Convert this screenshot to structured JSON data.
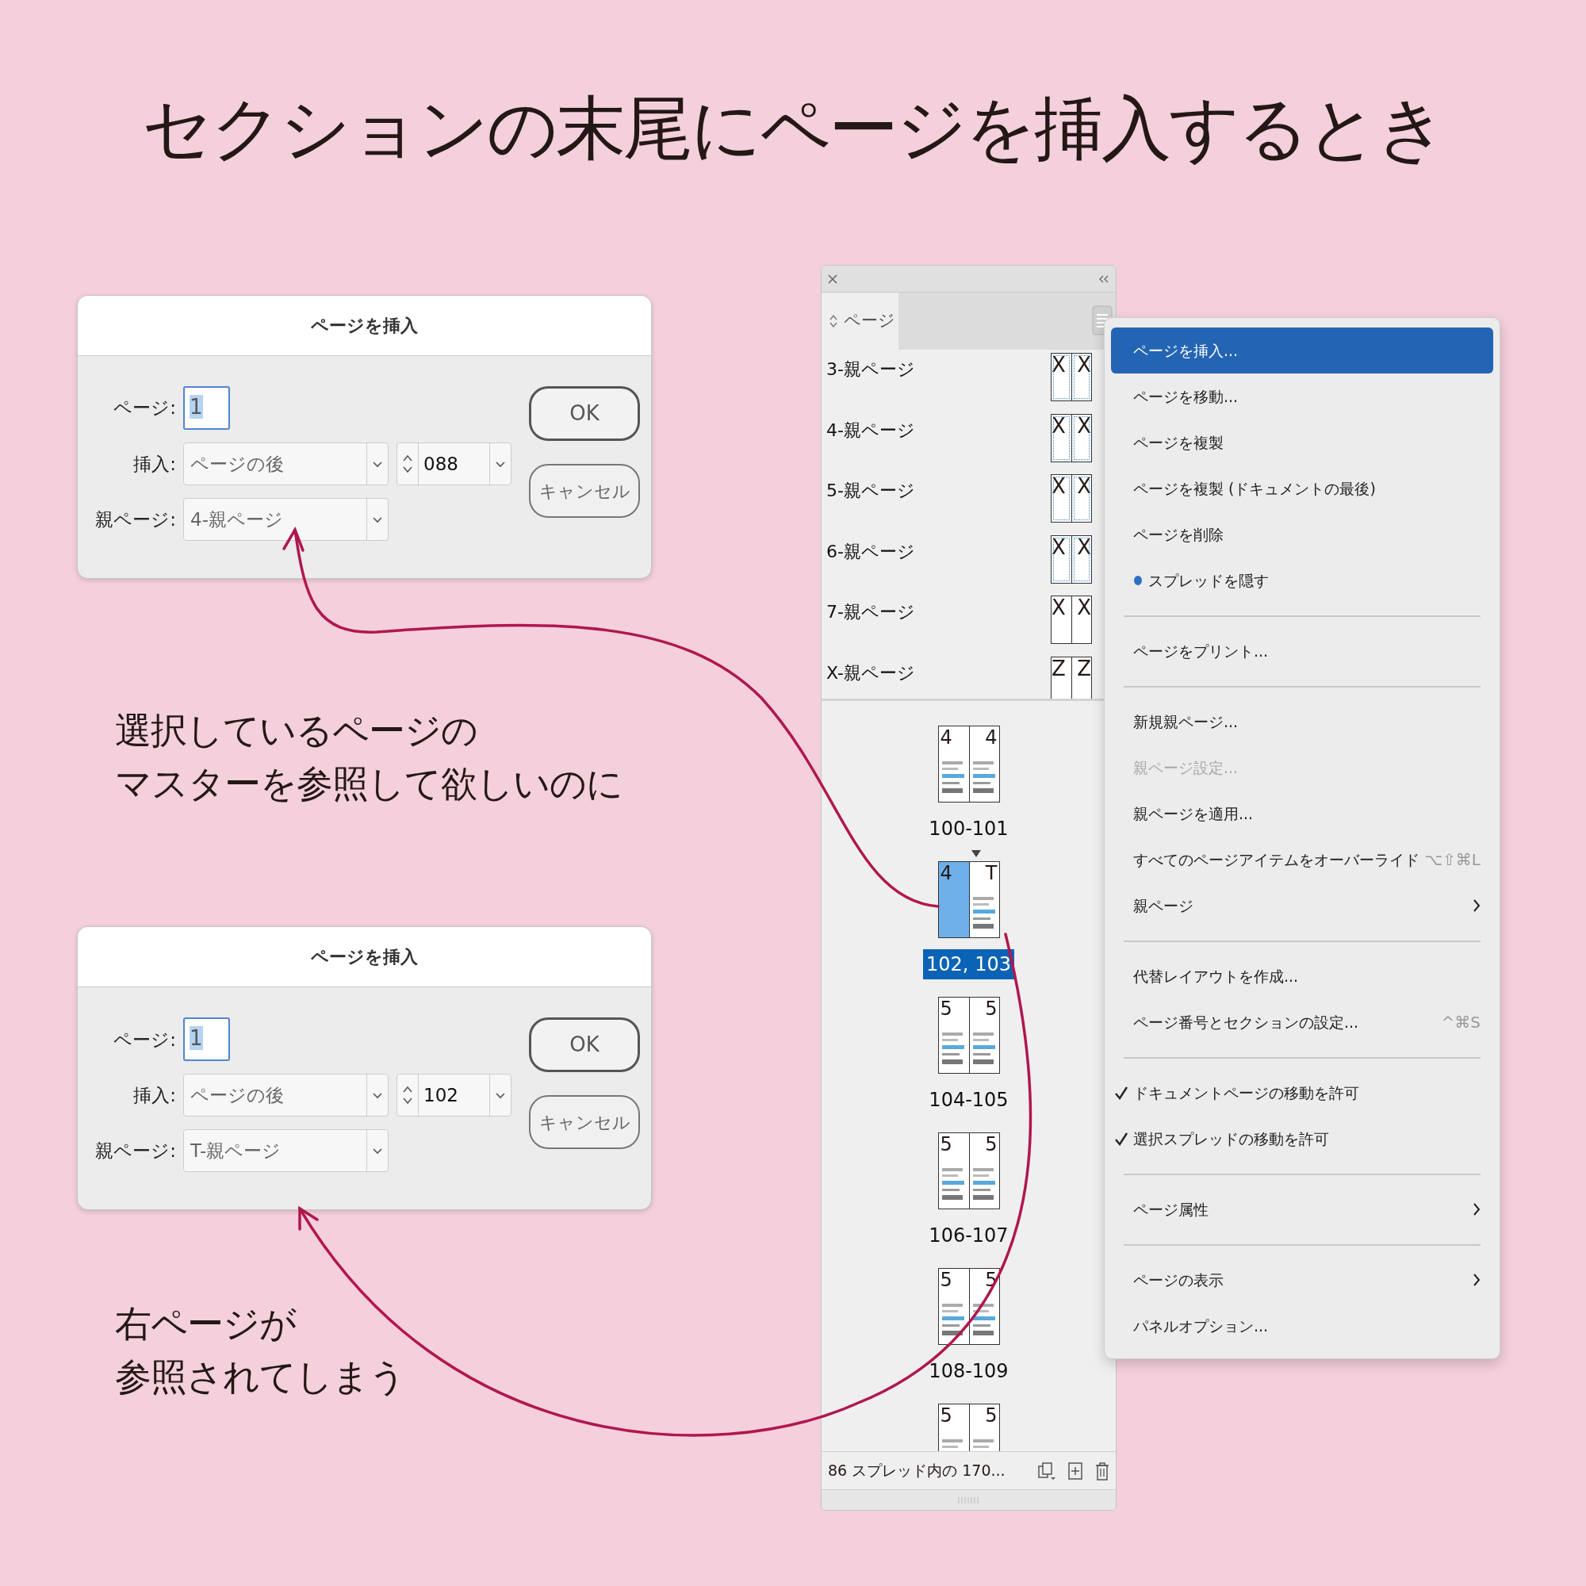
{
  "title": "セクションの末尾にページを挿入するとき",
  "sections": [
    {
      "dialog": {
        "title": "ページを挿入",
        "page_label": "ページ:",
        "page_value": "1",
        "insert_label": "挿入:",
        "insert_value": "ページの後",
        "insert_page": "088",
        "parent_label": "親ページ:",
        "parent_value": "4-親ページ",
        "ok": "OK",
        "cancel": "キャンセル"
      },
      "caption": [
        "選択しているページの",
        "マスターを参照して欲しいのに"
      ]
    },
    {
      "dialog": {
        "title": "ページを挿入",
        "page_label": "ページ:",
        "page_value": "1",
        "insert_label": "挿入:",
        "insert_value": "ページの後",
        "insert_page": "102",
        "parent_label": "親ページ:",
        "parent_value": "T-親ページ",
        "ok": "OK",
        "cancel": "キャンセル"
      },
      "caption": [
        "右ページが",
        "参照されてしまう"
      ]
    }
  ],
  "panel": {
    "tab": "ページ",
    "masters": [
      {
        "name": "3-親ページ",
        "left": "X",
        "right": "X",
        "guides": true
      },
      {
        "name": "4-親ページ",
        "left": "X",
        "right": "X",
        "guides": true
      },
      {
        "name": "5-親ページ",
        "left": "X",
        "right": "X",
        "guides": true
      },
      {
        "name": "6-親ページ",
        "left": "X",
        "right": "X",
        "guides": true
      },
      {
        "name": "7-親ページ",
        "left": "X",
        "right": "X",
        "guides": false
      },
      {
        "name": "X-親ページ",
        "left": "Z",
        "right": "Z",
        "guides": false
      }
    ],
    "spreads": [
      {
        "label": "100-101",
        "selected": false,
        "pages": [
          {
            "letter": "4",
            "selected": false
          },
          {
            "letter": "4",
            "selected": false
          }
        ]
      },
      {
        "label": "102, 103",
        "selected": true,
        "pages": [
          {
            "letter": "4",
            "selected": true
          },
          {
            "letter": "T",
            "selected": false,
            "current": true
          }
        ]
      },
      {
        "label": "104-105",
        "selected": false,
        "pages": [
          {
            "letter": "5",
            "selected": false
          },
          {
            "letter": "5",
            "selected": false
          }
        ]
      },
      {
        "label": "106-107",
        "selected": false,
        "pages": [
          {
            "letter": "5",
            "selected": false
          },
          {
            "letter": "5",
            "selected": false
          }
        ]
      },
      {
        "label": "108-109",
        "selected": false,
        "pages": [
          {
            "letter": "5",
            "selected": false
          },
          {
            "letter": "5",
            "selected": false
          }
        ]
      },
      {
        "pages": [
          {
            "letter": "5",
            "selected": false
          },
          {
            "letter": "5",
            "selected": false
          }
        ]
      }
    ],
    "footer": "86 スプレッド内の 170..."
  },
  "menu": {
    "items": [
      {
        "kind": "item",
        "label": "ページを挿入...",
        "selected": true,
        "disabled": false
      },
      {
        "kind": "item",
        "label": "ページを移動...",
        "selected": false,
        "disabled": false
      },
      {
        "kind": "item",
        "label": "ページを複製",
        "selected": false,
        "disabled": false
      },
      {
        "kind": "item",
        "label": "ページを複製 (ドキュメントの最後)",
        "selected": false,
        "disabled": false
      },
      {
        "kind": "item",
        "label": "ページを削除",
        "selected": false,
        "disabled": false
      },
      {
        "kind": "item",
        "label": "スプレッドを隠す",
        "selected": false,
        "disabled": false,
        "bullet": true
      },
      {
        "kind": "separator"
      },
      {
        "kind": "item",
        "label": "ページをプリント...",
        "selected": false,
        "disabled": false
      },
      {
        "kind": "separator"
      },
      {
        "kind": "item",
        "label": "新規親ページ...",
        "selected": false,
        "disabled": false
      },
      {
        "kind": "item",
        "label": "親ページ設定...",
        "selected": false,
        "disabled": true
      },
      {
        "kind": "item",
        "label": "親ページを適用...",
        "selected": false,
        "disabled": false
      },
      {
        "kind": "item",
        "label": "すべてのページアイテムをオーバーライド",
        "selected": false,
        "disabled": false,
        "shortcut": "⌥⇧⌘L"
      },
      {
        "kind": "item",
        "label": "親ページ",
        "selected": false,
        "disabled": false,
        "submenu": true
      },
      {
        "kind": "separator"
      },
      {
        "kind": "item",
        "label": "代替レイアウトを作成...",
        "selected": false,
        "disabled": false
      },
      {
        "kind": "item",
        "label": "ページ番号とセクションの設定...",
        "selected": false,
        "disabled": false,
        "shortcut": "^⌘S"
      },
      {
        "kind": "separator"
      },
      {
        "kind": "item",
        "label": "ドキュメントページの移動を許可",
        "selected": false,
        "disabled": false,
        "checked": true
      },
      {
        "kind": "item",
        "label": "選択スプレッドの移動を許可",
        "selected": false,
        "disabled": false,
        "checked": true
      },
      {
        "kind": "separator"
      },
      {
        "kind": "item",
        "label": "ページ属性",
        "selected": false,
        "disabled": false,
        "submenu": true
      },
      {
        "kind": "separator"
      },
      {
        "kind": "item",
        "label": "ページの表示",
        "selected": false,
        "disabled": false,
        "submenu": true
      },
      {
        "kind": "item",
        "label": "パネルオプション...",
        "selected": false,
        "disabled": false
      }
    ]
  }
}
